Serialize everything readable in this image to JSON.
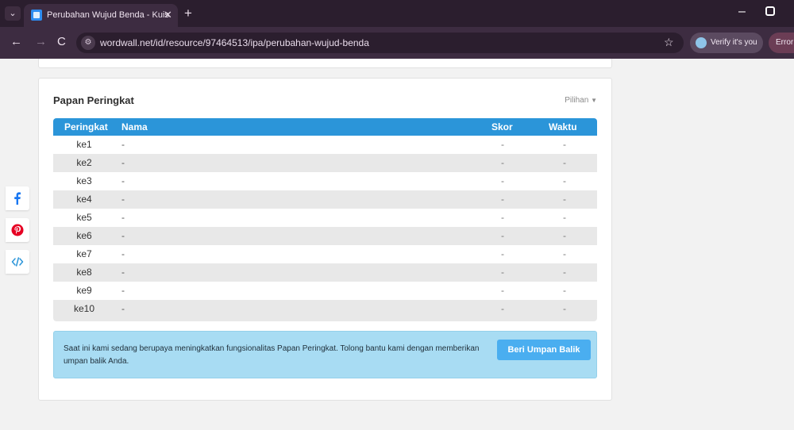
{
  "browser": {
    "tab_title": "Perubahan Wujud Benda - Kuis",
    "close_glyph": "✕",
    "new_tab_glyph": "+",
    "url": "wordwall.net/id/resource/97464513/ipa/perubahan-wujud-benda",
    "verify_label": "Verify it's you",
    "error_label": "Error",
    "icons": [
      "tab-menu-icon",
      "back-arrow-icon",
      "forward-arrow-icon",
      "reload-icon",
      "site-info-icon",
      "star-icon",
      "minimize-icon",
      "maximize-icon"
    ]
  },
  "leaderboard": {
    "title": "Papan Peringkat",
    "options_label": "Pilihan",
    "columns": {
      "rank": "Peringkat",
      "name": "Nama",
      "score": "Skor",
      "time": "Waktu"
    },
    "rows": [
      {
        "rank": "ke1",
        "name": "-",
        "score": "-",
        "time": "-"
      },
      {
        "rank": "ke2",
        "name": "-",
        "score": "-",
        "time": "-"
      },
      {
        "rank": "ke3",
        "name": "-",
        "score": "-",
        "time": "-"
      },
      {
        "rank": "ke4",
        "name": "-",
        "score": "-",
        "time": "-"
      },
      {
        "rank": "ke5",
        "name": "-",
        "score": "-",
        "time": "-"
      },
      {
        "rank": "ke6",
        "name": "-",
        "score": "-",
        "time": "-"
      },
      {
        "rank": "ke7",
        "name": "-",
        "score": "-",
        "time": "-"
      },
      {
        "rank": "ke8",
        "name": "-",
        "score": "-",
        "time": "-"
      },
      {
        "rank": "ke9",
        "name": "-",
        "score": "-",
        "time": "-"
      },
      {
        "rank": "ke10",
        "name": "-",
        "score": "-",
        "time": "-"
      }
    ]
  },
  "notice": {
    "text": "Saat ini kami sedang berupaya meningkatkan fungsionalitas Papan Peringkat. Tolong bantu kami dengan memberikan umpan balik Anda.",
    "button_label": "Beri Umpan Balik"
  },
  "share": [
    {
      "icon": "facebook-icon",
      "color": "#1877f2"
    },
    {
      "icon": "pinterest-icon",
      "color": "#e60023"
    },
    {
      "icon": "embed-code-icon",
      "color": "#2b95d9"
    }
  ],
  "colors": {
    "header_blue": "#2b95d9",
    "notice_bg": "#a8dcf3",
    "button_blue": "#4aaef0",
    "chrome": "#3d2c41"
  }
}
